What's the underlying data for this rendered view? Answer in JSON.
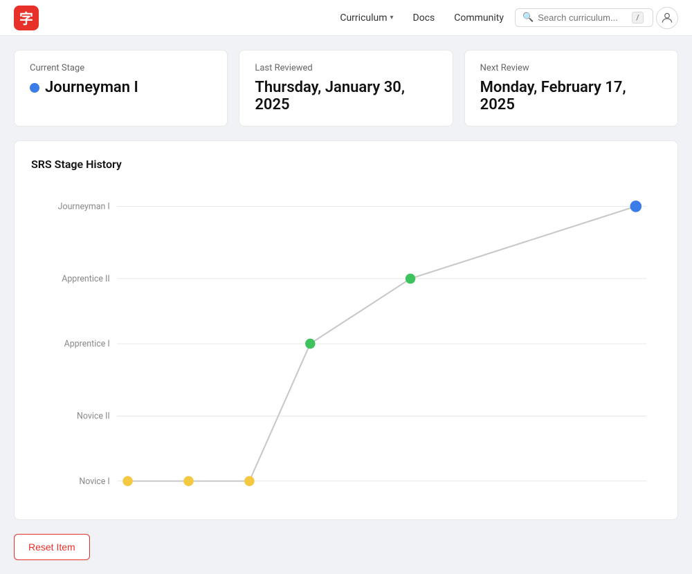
{
  "header": {
    "logo_char": "字",
    "nav": [
      {
        "label": "Curriculum",
        "has_dropdown": true
      },
      {
        "label": "Docs",
        "has_dropdown": false
      },
      {
        "label": "Community",
        "has_dropdown": false
      }
    ],
    "search_placeholder": "Search curriculum...",
    "kbd_hint": "/"
  },
  "stats": {
    "current_stage": {
      "label": "Current Stage",
      "value": "Journeyman I",
      "dot_color": "#3b7de8"
    },
    "last_reviewed": {
      "label": "Last Reviewed",
      "value": "Thursday, January 30, 2025"
    },
    "next_review": {
      "label": "Next Review",
      "value": "Monday, February 17, 2025"
    }
  },
  "chart": {
    "title": "SRS Stage History",
    "y_labels": [
      "Journeyman I",
      "Apprentice II",
      "Apprentice I",
      "Novice II",
      "Novice I"
    ],
    "points": [
      {
        "stage": "Novice I",
        "color": "#f5c842"
      },
      {
        "stage": "Novice I",
        "color": "#f5c842"
      },
      {
        "stage": "Novice I",
        "color": "#f5c842"
      },
      {
        "stage": "Apprentice I",
        "color": "#3dc25e"
      },
      {
        "stage": "Apprentice II",
        "color": "#3dc25e"
      },
      {
        "stage": "Journeyman I",
        "color": "#3b7de8"
      }
    ]
  },
  "buttons": {
    "reset_label": "Reset Item"
  }
}
